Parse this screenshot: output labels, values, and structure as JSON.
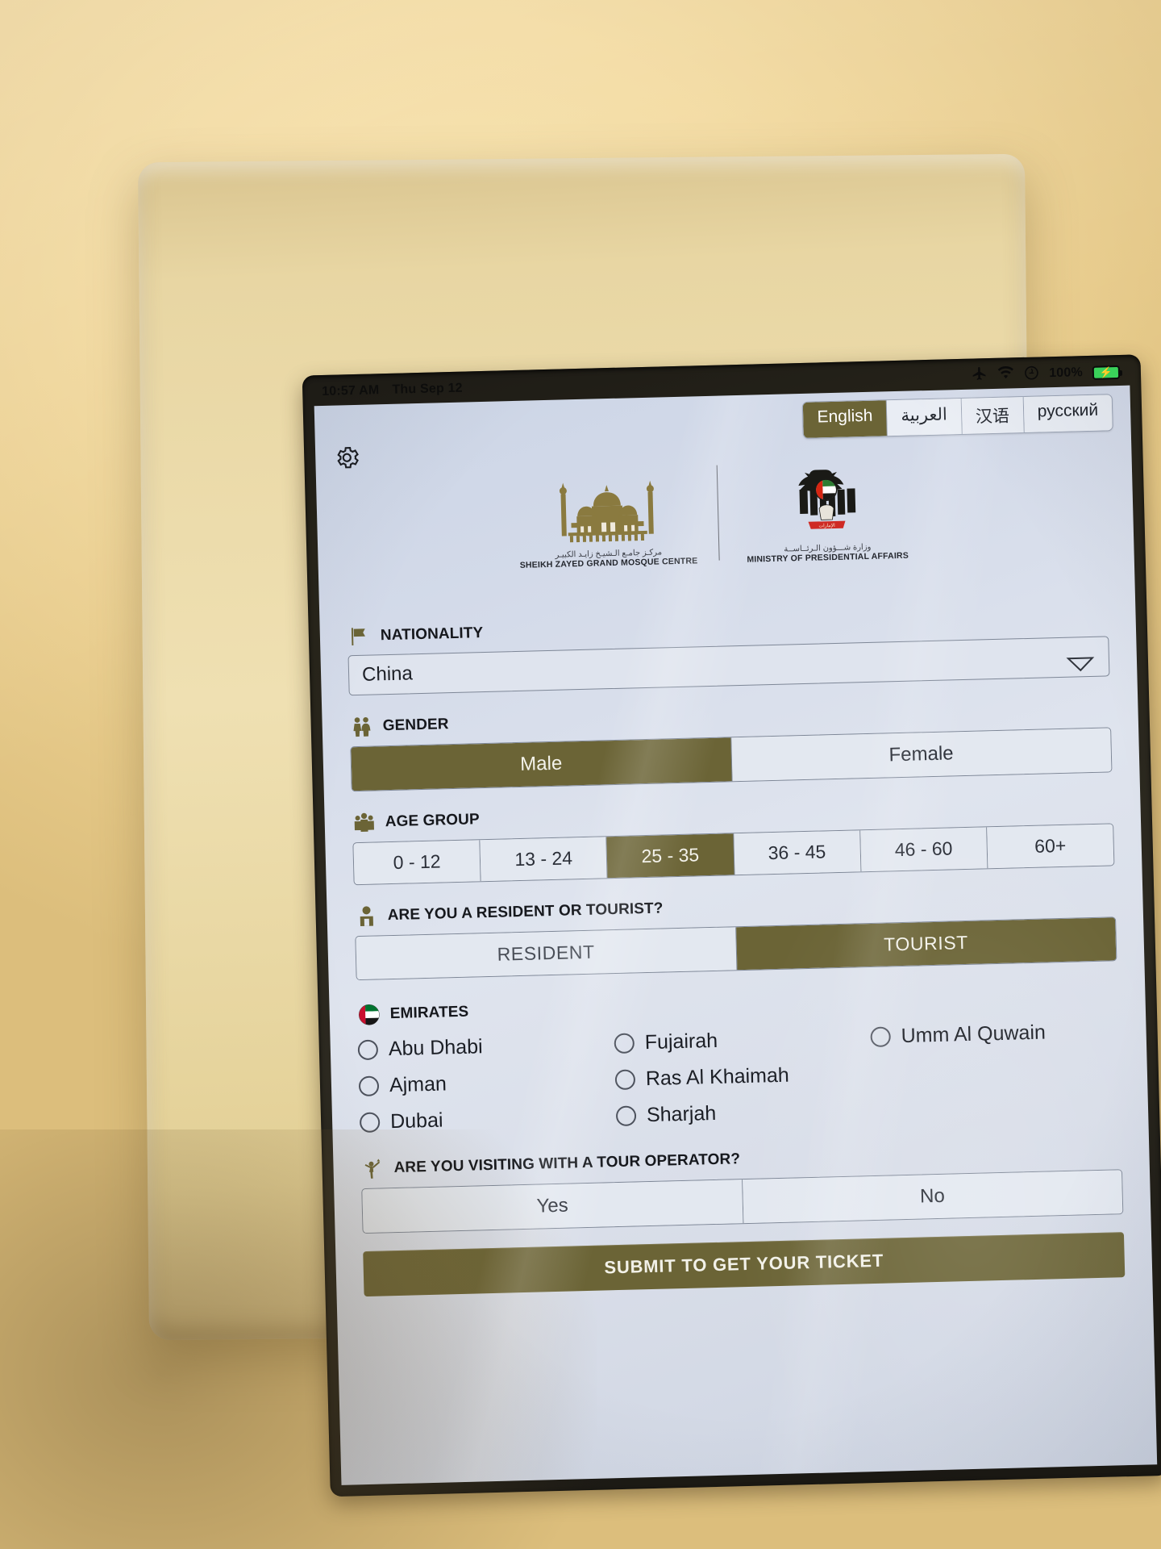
{
  "status_bar": {
    "time": "10:57 AM",
    "date": "Thu Sep 12",
    "airplane_icon": "airplane-mode-icon",
    "wifi_icon": "wifi-icon",
    "dnd_icon": "do-not-disturb-icon",
    "battery_percent": "100%",
    "battery_icon": "battery-charging-icon"
  },
  "language_bar": {
    "options": [
      {
        "label": "English",
        "active": true
      },
      {
        "label": "العربية",
        "active": false
      },
      {
        "label": "汉语",
        "active": false
      },
      {
        "label": "русский",
        "active": false
      }
    ]
  },
  "settings": {
    "icon": "gear-icon"
  },
  "branding": {
    "mosque": {
      "arabic": "مركـز جامـع الـشيـخ زايـد الكبيـر",
      "english": "SHEIKH ZAYED GRAND MOSQUE CENTRE",
      "icon": "mosque-silhouette-icon"
    },
    "ministry": {
      "arabic": "وزارة شـــؤون الـرئــاســة",
      "english": "MINISTRY OF PRESIDENTIAL AFFAIRS",
      "icon": "uae-falcon-emblem-icon"
    }
  },
  "form": {
    "nationality": {
      "label": "NATIONALITY",
      "icon": "flag-icon",
      "value": "China",
      "caret_icon": "chevron-down-icon"
    },
    "gender": {
      "label": "GENDER",
      "icon": "male-female-icon",
      "options": [
        {
          "label": "Male",
          "active": true
        },
        {
          "label": "Female",
          "active": false
        }
      ]
    },
    "age_group": {
      "label": "AGE GROUP",
      "icon": "group-of-people-icon",
      "options": [
        {
          "label": "0 - 12",
          "active": false
        },
        {
          "label": "13 - 24",
          "active": false
        },
        {
          "label": "25 - 35",
          "active": true
        },
        {
          "label": "36 - 45",
          "active": false
        },
        {
          "label": "46 - 60",
          "active": false
        },
        {
          "label": "60+",
          "active": false
        }
      ]
    },
    "resident_tourist": {
      "label": "ARE YOU A RESIDENT OR TOURIST?",
      "icon": "person-icon",
      "options": [
        {
          "label": "RESIDENT",
          "active": false
        },
        {
          "label": "TOURIST",
          "active": true
        }
      ]
    },
    "emirates": {
      "label": "EMIRATES",
      "icon": "uae-flag-icon",
      "options": [
        {
          "label": "Abu Dhabi",
          "selected": false
        },
        {
          "label": "Fujairah",
          "selected": false
        },
        {
          "label": "Umm Al Quwain",
          "selected": false
        },
        {
          "label": "Ajman",
          "selected": false
        },
        {
          "label": "Ras Al Khaimah",
          "selected": false
        },
        {
          "label": "",
          "selected": false
        },
        {
          "label": "Dubai",
          "selected": false
        },
        {
          "label": "Sharjah",
          "selected": false
        },
        {
          "label": "",
          "selected": false
        }
      ]
    },
    "tour_operator": {
      "label": "ARE YOU VISITING WITH A TOUR OPERATOR?",
      "icon": "tour-guide-icon",
      "options": [
        {
          "label": "Yes",
          "active": false
        },
        {
          "label": "No",
          "active": false
        }
      ]
    },
    "submit": {
      "label": "SUBMIT TO GET YOUR TICKET"
    }
  },
  "colors": {
    "accent_olive": "#6b6436",
    "screen_bg": "#d8dde8",
    "text_dark": "#16181d",
    "battery_green": "#3ad15a"
  }
}
